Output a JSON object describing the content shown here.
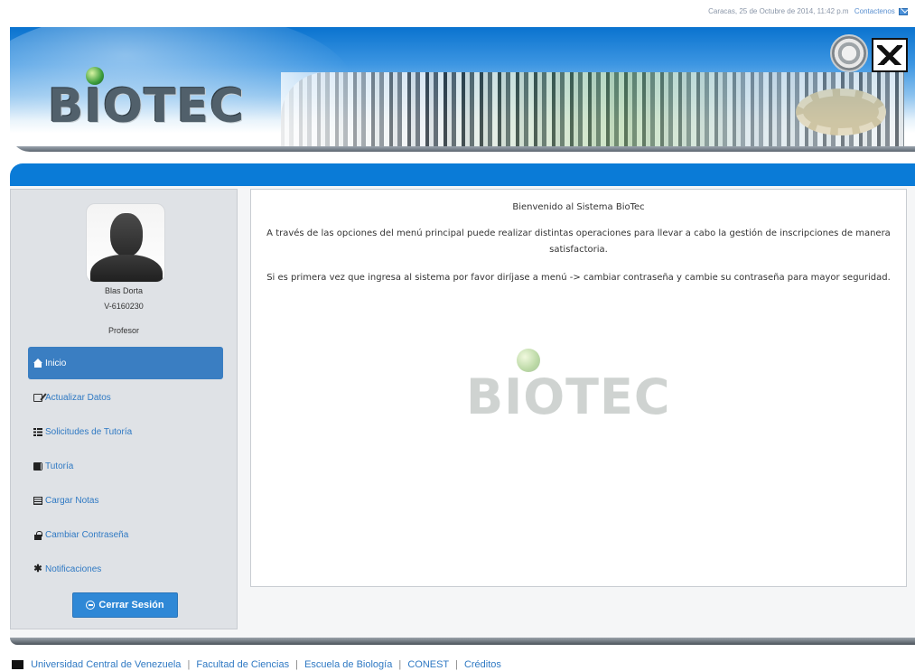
{
  "topbar": {
    "datetime": "Caracas, 25 de Octubre de 2014, 11:42 p.m",
    "contact_label": "Contactenos"
  },
  "header": {
    "logo_text": "BIOTEC"
  },
  "sidebar": {
    "user": {
      "name": "Blas Dorta",
      "id": "V-6160230",
      "role": "Profesor"
    },
    "items": [
      {
        "label": "Inicio",
        "icon": "home-icon",
        "active": true
      },
      {
        "label": "Actualizar Datos",
        "icon": "edit-icon",
        "active": false
      },
      {
        "label": "Solicitudes de Tutoría",
        "icon": "list-icon",
        "active": false
      },
      {
        "label": "Tutoría",
        "icon": "book-icon",
        "active": false
      },
      {
        "label": "Cargar Notas",
        "icon": "notes-icon",
        "active": false
      },
      {
        "label": "Cambiar Contraseña",
        "icon": "lock-icon",
        "active": false
      },
      {
        "label": "Notificaciones",
        "icon": "asterisk-icon",
        "active": false
      }
    ],
    "logout_label": "Cerrar Sesión"
  },
  "main": {
    "title": "Bienvenido al Sistema BioTec",
    "paragraph1": "A través de las opciones del menú principal puede realizar distintas operaciones para llevar a cabo la gestión de inscripciones de manera satisfactoria.",
    "paragraph2": "Si es primera vez que ingresa al sistema por favor diríjase a menú -> cambiar contraseña y cambie su contraseña para mayor seguridad.",
    "watermark": "BIOTEC"
  },
  "footer": {
    "links": [
      "Universidad Central de Venezuela",
      "Facultad de Ciencias",
      "Escuela de Biología",
      "CONEST",
      "Créditos"
    ]
  },
  "colors": {
    "brand_blue": "#0a7bd7",
    "active_nav": "#3a7ec2",
    "button_blue": "#2f88d6",
    "link_blue": "#2f79c3"
  }
}
